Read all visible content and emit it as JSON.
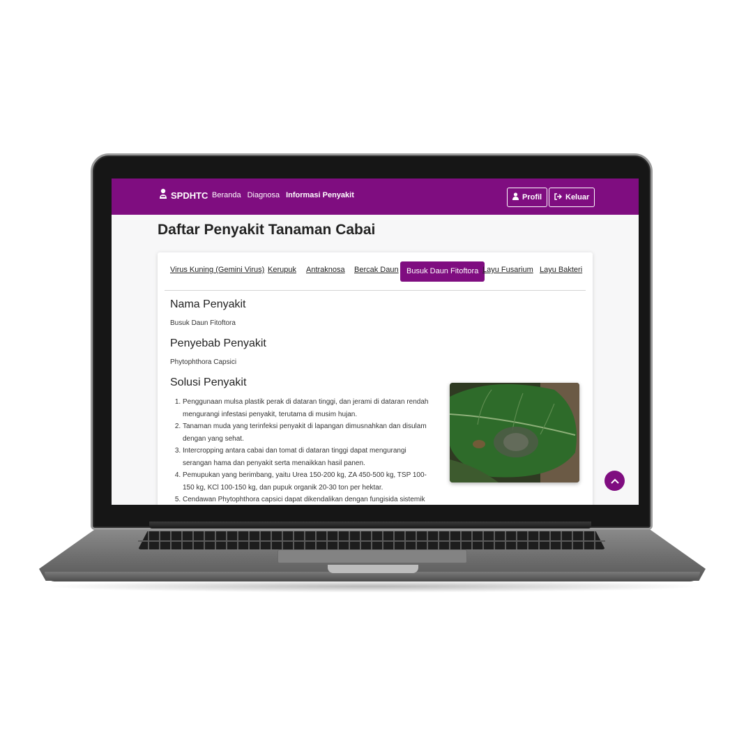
{
  "navbar": {
    "brand": "SPDHTC",
    "links": [
      "Beranda",
      "Diagnosa",
      "Informasi Penyakit"
    ],
    "profil_label": "Profil",
    "keluar_label": "Keluar",
    "color": "#7f0d80"
  },
  "page": {
    "title": "Daftar Penyakit Tanaman Cabai"
  },
  "tabs": {
    "items": [
      "Virus Kuning (Gemini Virus)",
      "Kerupuk",
      "Antraknosa",
      "Bercak Daun",
      "Busuk Daun Fitoftora",
      "Layu Fusarium",
      "Layu Bakteri"
    ],
    "active": "Busuk Daun Fitoftora"
  },
  "disease": {
    "name_heading": "Nama Penyakit",
    "name": "Busuk Daun Fitoftora",
    "cause_heading": "Penyebab Penyakit",
    "cause": "Phytophthora Capsici",
    "solution_heading": "Solusi Penyakit",
    "solutions": [
      "Penggunaan mulsa plastik perak di dataran tinggi, dan jerami di dataran rendah mengurangi infestasi penyakit, terutama di musim hujan.",
      "Tanaman muda yang terinfeksi penyakit di lapangan dimusnahkan dan disulam dengan yang sehat.",
      "Intercropping antara cabai dan tomat di dataran tinggi dapat mengurangi serangan hama dan penyakit serta menaikkan hasil panen.",
      "Pemupukan yang berimbang, yaitu Urea 150-200 kg, ZA 450-500 kg, TSP 100-150 kg, KCl 100-150 kg, dan pupuk organik 20-30 ton per hektar.",
      "Cendawan Phytophthora capsici dapat dikendalikan dengan fungisida sistemik"
    ]
  },
  "icons": {
    "brand": "user-tie-icon",
    "profil": "user-icon",
    "keluar": "sign-out-icon",
    "scroll_top": "chevron-up-icon"
  }
}
